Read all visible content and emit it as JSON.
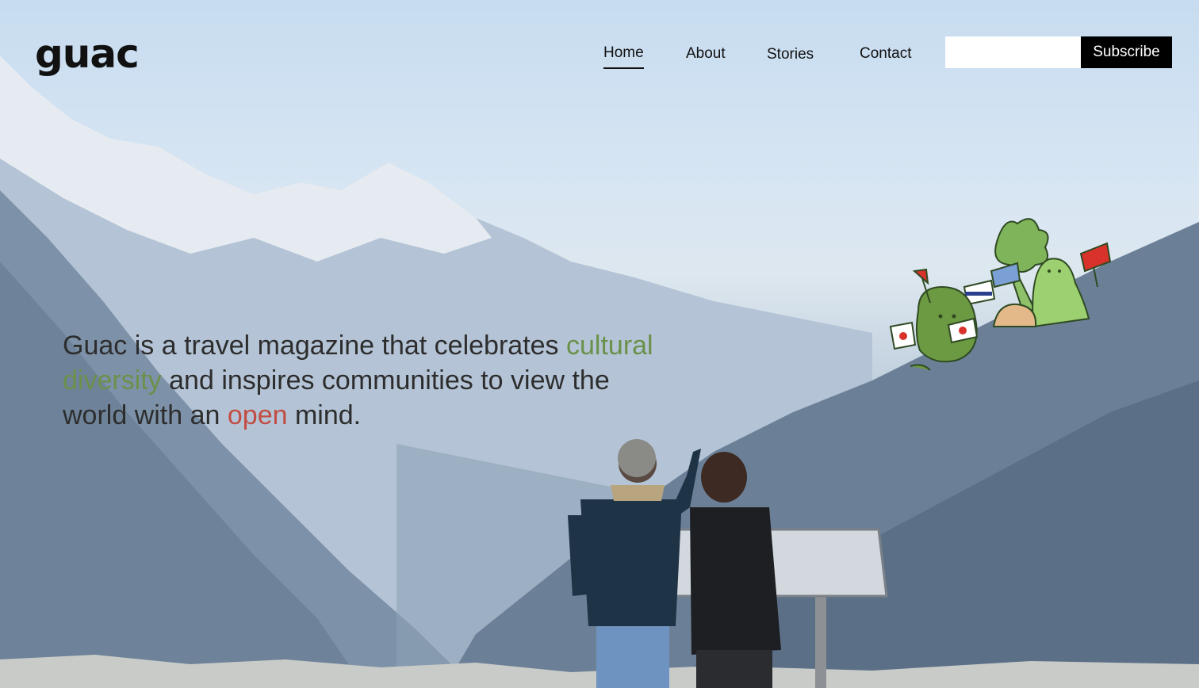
{
  "brand": {
    "logo_text": "guac"
  },
  "nav": {
    "items": [
      {
        "label": "Home",
        "active": true
      },
      {
        "label": "About",
        "active": false
      },
      {
        "label": "Stories",
        "active": false
      },
      {
        "label": "Contact",
        "active": false
      }
    ]
  },
  "subscribe": {
    "input_value": "",
    "button_label": "Subscribe"
  },
  "hero": {
    "tagline_part1": "Guac is a travel magazine that celebrates ",
    "tagline_highlight1": "cultural diversity",
    "tagline_part2": " and inspires communities to view the world with an ",
    "tagline_highlight2": "open",
    "tagline_part3": " mind.",
    "image": "hero-mountains-photo",
    "illustration": "vegetable-mascots-with-flags-illustration"
  },
  "colors": {
    "accent_green": "#6a914a",
    "accent_red": "#c24d43",
    "text_dark": "#2d2d2d",
    "button_bg": "#000000"
  }
}
